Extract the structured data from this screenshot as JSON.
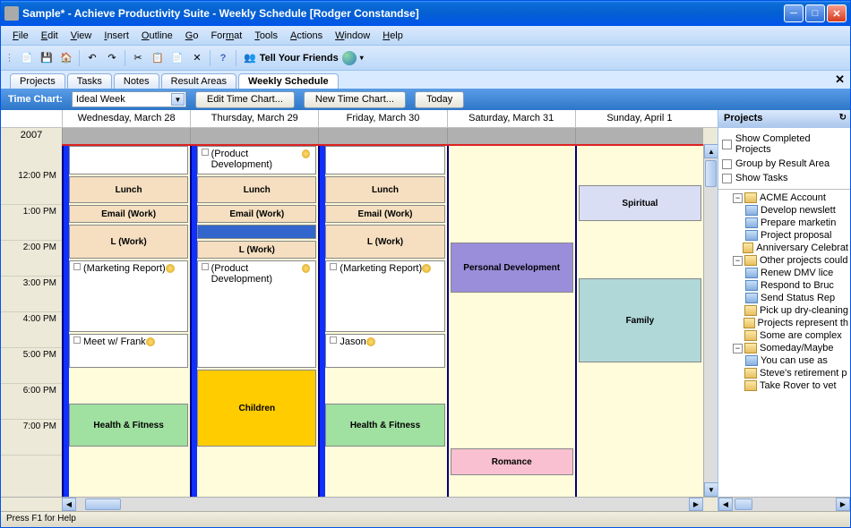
{
  "window": {
    "title": "Sample* - Achieve Productivity Suite - Weekly Schedule [Rodger Constandse]"
  },
  "menu": {
    "file": "File",
    "edit": "Edit",
    "view": "View",
    "insert": "Insert",
    "outline": "Outline",
    "go": "Go",
    "format": "Format",
    "tools": "Tools",
    "actions": "Actions",
    "window": "Window",
    "help": "Help"
  },
  "toolbar": {
    "tell": "Tell Your Friends"
  },
  "tabs": {
    "projects": "Projects",
    "tasks": "Tasks",
    "notes": "Notes",
    "resultareas": "Result Areas",
    "weekly": "Weekly Schedule"
  },
  "controlbar": {
    "label": "Time Chart:",
    "selected": "Ideal Week",
    "edit": "Edit Time Chart...",
    "newchart": "New Time Chart...",
    "today": "Today"
  },
  "year": "2007",
  "days": {
    "d1": "Wednesday, March 28",
    "d2": "Thursday, March 29",
    "d3": "Friday, March 30",
    "d4": "Saturday, March 31",
    "d5": "Sunday, April 1"
  },
  "times": {
    "t12": "12:00 PM",
    "t1": "1:00 PM",
    "t2": "2:00 PM",
    "t3": "3:00 PM",
    "t4": "4:00 PM",
    "t5": "5:00 PM",
    "t6": "6:00 PM",
    "t7": "7:00 PM"
  },
  "events": {
    "wed": {
      "lunch": "Lunch",
      "email": "Email (Work)",
      "lwork": "L (Work)",
      "mktg": "(Marketing Report)",
      "meet": "Meet w/ Frank",
      "health": "Health & Fitness"
    },
    "thu": {
      "proddev": "(Product Development)",
      "lunch": "Lunch",
      "email": "Email (Work)",
      "lwork": "L (Work)",
      "proddev2": "(Product Development)",
      "children": "Children"
    },
    "fri": {
      "lunch": "Lunch",
      "email": "Email (Work)",
      "lwork": "L (Work)",
      "mktg": "(Marketing Report)",
      "jason": "Jason",
      "health": "Health & Fitness"
    },
    "sat": {
      "personal": "Personal Development",
      "romance": "Romance"
    },
    "sun": {
      "spiritual": "Spiritual",
      "family": "Family"
    }
  },
  "projects": {
    "title": "Projects",
    "opts": {
      "completed": "Show Completed Projects",
      "group": "Group by Result Area",
      "tasks": "Show Tasks"
    },
    "tree": {
      "acme": "ACME Account",
      "newslet": "Develop newslett",
      "marketin": "Prepare marketin",
      "proposal": "Project proposal",
      "anniv": "Anniversary Celebrat",
      "other": "Other projects could",
      "dmv": "Renew DMV lice",
      "bruc": "Respond to Bruc",
      "status": "Send Status Rep",
      "dryclean": "Pick up dry-cleaning",
      "represent": "Projects represent th",
      "complex": "Some are complex",
      "someday": "Someday/Maybe",
      "useas": "You can use as",
      "retire": "Steve's retirement p",
      "rover": "Take Rover to vet"
    }
  },
  "status": "Press F1 for Help"
}
